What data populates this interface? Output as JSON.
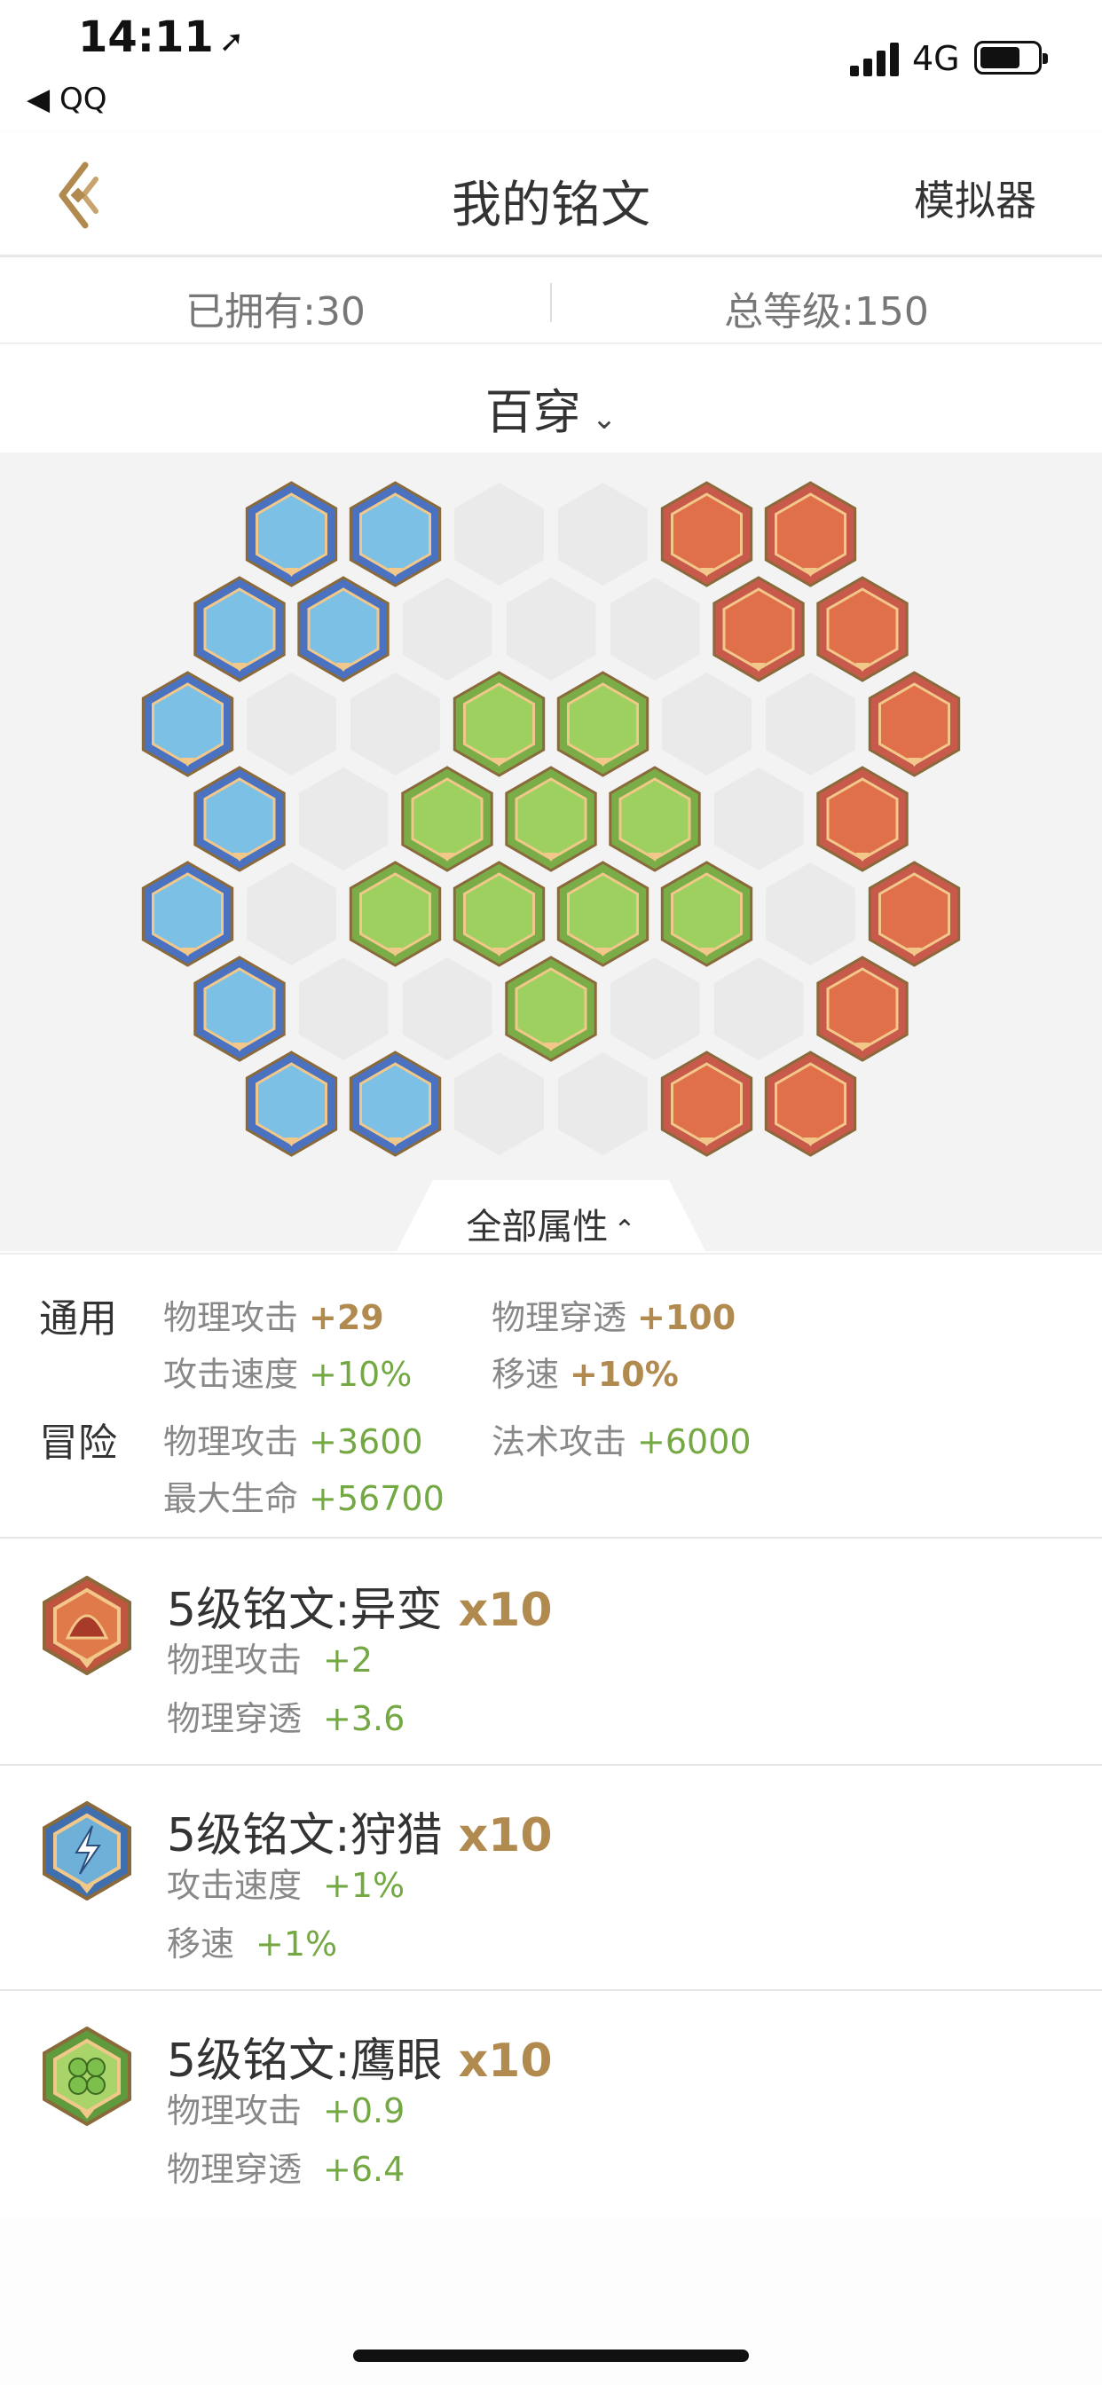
{
  "status_bar": {
    "time": "14:11",
    "back_app": "◀ QQ",
    "network": "4G"
  },
  "nav": {
    "title": "我的铭文",
    "simulator": "模拟器"
  },
  "stats": {
    "owned": "已拥有:30",
    "total_level": "总等级:150"
  },
  "preset": {
    "name": "百穿"
  },
  "board": {
    "colors": {
      "blue": "#4a72c0",
      "red": "#c85a4c",
      "green": "#7aac48",
      "empty": "#e6e6e6"
    },
    "rows": [
      [
        "blue",
        "blue",
        "empty",
        "empty",
        "red",
        "red"
      ],
      [
        "blue",
        "blue",
        "empty",
        "empty",
        "empty",
        "red",
        "red"
      ],
      [
        "blue",
        "empty",
        "empty",
        "green",
        "green",
        "empty",
        "empty",
        "red"
      ],
      [
        "blue",
        "empty",
        "green",
        "green",
        "green",
        "empty",
        "red"
      ],
      [
        "blue",
        "empty",
        "green",
        "green",
        "green",
        "green",
        "empty",
        "red"
      ],
      [
        "blue",
        "empty",
        "empty",
        "green",
        "empty",
        "empty",
        "red"
      ],
      [
        "blue",
        "blue",
        "empty",
        "empty",
        "red",
        "red"
      ]
    ]
  },
  "all_attributes": {
    "label": "全部属性"
  },
  "attributes": {
    "general": {
      "label": "通用",
      "items": [
        {
          "name": "物理攻击",
          "value": "+29"
        },
        {
          "name": "物理穿透",
          "value": "+100"
        },
        {
          "name": "攻击速度",
          "value": "+10%"
        },
        {
          "name": "移速",
          "value": "+10%"
        }
      ]
    },
    "adventure": {
      "label": "冒险",
      "items": [
        {
          "name": "物理攻击",
          "value": "+3600"
        },
        {
          "name": "法术攻击",
          "value": "+6000"
        },
        {
          "name": "最大生命",
          "value": "+56700"
        }
      ]
    }
  },
  "runes": [
    {
      "title": "5级铭文:异变",
      "count": "x10",
      "icon": "red-rune-icon",
      "stats": [
        {
          "name": "物理攻击",
          "value": "+2"
        },
        {
          "name": "物理穿透",
          "value": "+3.6"
        }
      ]
    },
    {
      "title": "5级铭文:狩猎",
      "count": "x10",
      "icon": "blue-rune-icon",
      "stats": [
        {
          "name": "攻击速度",
          "value": "+1%"
        },
        {
          "name": "移速",
          "value": "+1%"
        }
      ]
    },
    {
      "title": "5级铭文:鹰眼",
      "count": "x10",
      "icon": "green-rune-icon",
      "stats": [
        {
          "name": "物理攻击",
          "value": "+0.9"
        },
        {
          "name": "物理穿透",
          "value": "+6.4"
        }
      ]
    }
  ]
}
